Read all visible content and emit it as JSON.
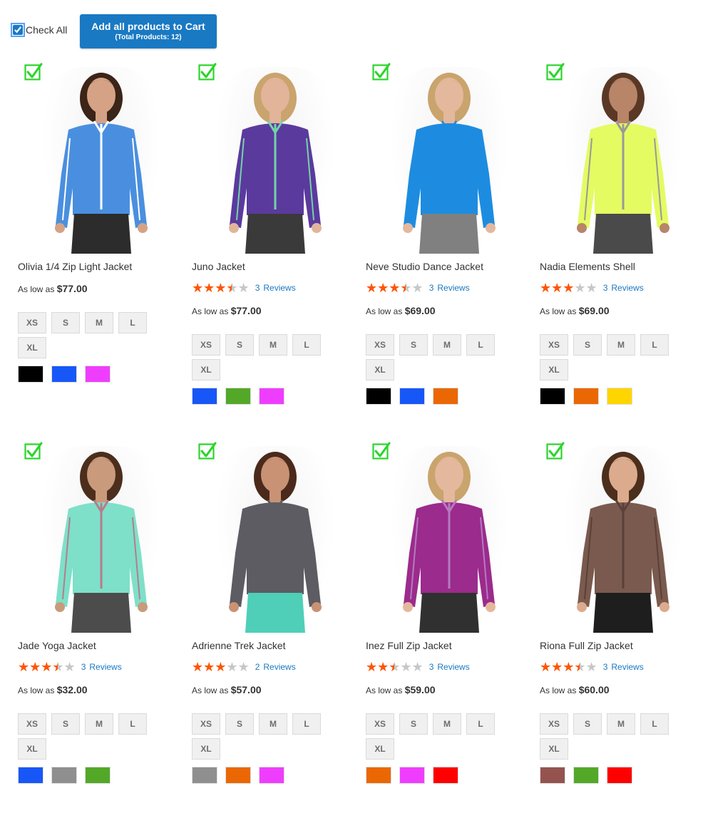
{
  "toolbar": {
    "check_all_label": "Check All",
    "check_all_checked": true,
    "add_button_label": "Add all products to Cart",
    "add_button_sub": "(Total Products: 12)"
  },
  "colors": {
    "accent": "#1979c3",
    "star": "#ff5501",
    "tick": "#2bd42b"
  },
  "products": [
    {
      "name": "Olivia 1/4 Zip Light Jacket",
      "rating": null,
      "reviews_count": "",
      "reviews_label": "",
      "price_prefix": "As low as",
      "price": "$77.00",
      "sizes": [
        "XS",
        "S",
        "M",
        "L",
        "XL"
      ],
      "colors": [
        "#000000",
        "#1857f7",
        "#ef3dff"
      ],
      "photo": {
        "top": "#4a8fdf",
        "trim": "#ffffff",
        "bottom": "#2c2c2c",
        "skin": "#d5a285",
        "hair": "#3b2418"
      }
    },
    {
      "name": "Juno Jacket",
      "rating": 3.5,
      "reviews_count": "3",
      "reviews_label": "Reviews",
      "price_prefix": "As low as",
      "price": "$77.00",
      "sizes": [
        "XS",
        "S",
        "M",
        "L",
        "XL"
      ],
      "colors": [
        "#1857f7",
        "#53a828",
        "#ef3dff"
      ],
      "photo": {
        "top": "#5b3a9e",
        "trim": "#73d4a8",
        "bottom": "#3a3a3a",
        "skin": "#e2b49a",
        "hair": "#c9a46d"
      }
    },
    {
      "name": "Neve Studio Dance Jacket",
      "rating": 3.5,
      "reviews_count": "3",
      "reviews_label": "Reviews",
      "price_prefix": "As low as",
      "price": "$69.00",
      "sizes": [
        "XS",
        "S",
        "M",
        "L",
        "XL"
      ],
      "colors": [
        "#000000",
        "#1857f7",
        "#eb6703"
      ],
      "photo": {
        "top": "#1d8ce0",
        "trim": "#1d8ce0",
        "bottom": "#808080",
        "skin": "#e4b89c",
        "hair": "#c9a46d"
      }
    },
    {
      "name": "Nadia Elements Shell",
      "rating": 3,
      "reviews_count": "3",
      "reviews_label": "Reviews",
      "price_prefix": "As low as",
      "price": "$69.00",
      "sizes": [
        "XS",
        "S",
        "M",
        "L",
        "XL"
      ],
      "colors": [
        "#000000",
        "#eb6703",
        "#ffd500"
      ],
      "photo": {
        "top": "#e4fb62",
        "trim": "#999999",
        "bottom": "#4a4a4a",
        "skin": "#b88568",
        "hair": "#5a3826"
      }
    },
    {
      "name": "Jade Yoga Jacket",
      "rating": 3.5,
      "reviews_count": "3",
      "reviews_label": "Reviews",
      "price_prefix": "As low as",
      "price": "$32.00",
      "sizes": [
        "XS",
        "S",
        "M",
        "L",
        "XL"
      ],
      "colors": [
        "#1857f7",
        "#8f8f8f",
        "#53a828"
      ],
      "photo": {
        "top": "#7ee0c9",
        "trim": "#b57d8c",
        "bottom": "#4c4c4c",
        "skin": "#c99a7c",
        "hair": "#4c2e1c"
      }
    },
    {
      "name": "Adrienne Trek Jacket",
      "rating": 3,
      "reviews_count": "2",
      "reviews_label": "Reviews",
      "price_prefix": "As low as",
      "price": "$57.00",
      "sizes": [
        "XS",
        "S",
        "M",
        "L",
        "XL"
      ],
      "colors": [
        "#8f8f8f",
        "#eb6703",
        "#ef3dff"
      ],
      "photo": {
        "top": "#5c5c62",
        "trim": "#5c5c62",
        "bottom": "#4fcfb8",
        "skin": "#c99275",
        "hair": "#4b2a1b"
      }
    },
    {
      "name": "Inez Full Zip Jacket",
      "rating": 2.5,
      "reviews_count": "3",
      "reviews_label": "Reviews",
      "price_prefix": "As low as",
      "price": "$59.00",
      "sizes": [
        "XS",
        "S",
        "M",
        "L",
        "XL"
      ],
      "colors": [
        "#eb6703",
        "#ef3dff",
        "#ff0000"
      ],
      "photo": {
        "top": "#9b2b8c",
        "trim": "#b57ac0",
        "bottom": "#303030",
        "skin": "#e4b89c",
        "hair": "#c9a46d"
      }
    },
    {
      "name": "Riona Full Zip Jacket",
      "rating": 3.5,
      "reviews_count": "3",
      "reviews_label": "Reviews",
      "price_prefix": "As low as",
      "price": "$60.00",
      "sizes": [
        "XS",
        "S",
        "M",
        "L",
        "XL"
      ],
      "colors": [
        "#955350",
        "#53a828",
        "#ff0000"
      ],
      "photo": {
        "top": "#7a5a4e",
        "trim": "#5a4038",
        "bottom": "#1e1e1e",
        "skin": "#dcab8e",
        "hair": "#4c2e1c"
      }
    }
  ]
}
